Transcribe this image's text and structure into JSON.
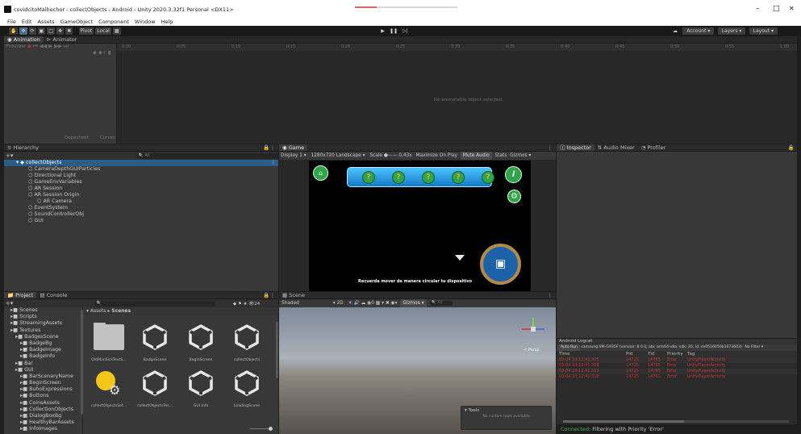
{
  "window": {
    "title": "covidcitoMalhechor - collectObjects - Android - Unity 2020.3.32f1 Personal <DX11>",
    "min": "–",
    "max": "□",
    "close": "✕"
  },
  "menu": [
    "File",
    "Edit",
    "Assets",
    "GameObject",
    "Component",
    "Window",
    "Help"
  ],
  "toolbar": {
    "pivot": "Pivot",
    "local": "Local",
    "account": "Account",
    "layers": "Layers",
    "layout": "Layout"
  },
  "animation": {
    "tabs": [
      "Animation",
      "Animator"
    ],
    "preview": "Preview",
    "ruler": [
      "0:00",
      "0:05",
      "0:10",
      "0:15",
      "0:20",
      "0:25",
      "0:30",
      "0:35",
      "0:40",
      "0:45",
      "0:50",
      "0:55",
      "1:00"
    ],
    "empty_message": "No animatable object selected.",
    "bottom_tabs": [
      "Dopesheet",
      "Curves"
    ]
  },
  "hierarchy": {
    "tab": "Hierarchy",
    "search_placeholder": "All",
    "scene": "collectObjects",
    "items": [
      {
        "label": "CameraDepthGUIParticles",
        "indent": 2
      },
      {
        "label": "Directional Light",
        "indent": 2
      },
      {
        "label": "GameEnvVariables",
        "indent": 2
      },
      {
        "label": "AR Session",
        "indent": 2
      },
      {
        "label": "AR Session Origin",
        "indent": 2
      },
      {
        "label": "AR Camera",
        "indent": 3
      },
      {
        "label": "EventSystem",
        "indent": 2
      },
      {
        "label": "SoundControllerObj",
        "indent": 2
      },
      {
        "label": "GUI",
        "indent": 2
      }
    ]
  },
  "game": {
    "tab": "Game",
    "display": "Display 1",
    "resolution": "1280x720 Landscape",
    "scale_label": "Scale",
    "scale_value": "0.43x",
    "toggles": [
      "Maximize On Play",
      "Mute Audio",
      "Stats",
      "Gizmos"
    ],
    "footer_text": "Recuerda mover de manera circular tu dispositivo",
    "tokens": [
      "?",
      "?",
      "?",
      "?",
      "?"
    ],
    "info_glyph": "i"
  },
  "inspector": {
    "tabs": [
      "Inspector",
      "Audio Mixer",
      "Profiler"
    ]
  },
  "project": {
    "tabs": [
      "Project",
      "Console"
    ],
    "count": "24",
    "breadcrumb": [
      "Assets",
      "Scenes"
    ],
    "tree": [
      {
        "label": "Scenes",
        "indent": 1
      },
      {
        "label": "Scripts",
        "indent": 1
      },
      {
        "label": "StreamingAssets",
        "indent": 1
      },
      {
        "label": "Textures",
        "indent": 1
      },
      {
        "label": "BadgesScene",
        "indent": 2
      },
      {
        "label": "BadgeBg",
        "indent": 3
      },
      {
        "label": "BadgeImage",
        "indent": 3
      },
      {
        "label": "BadgeInfo",
        "indent": 3
      },
      {
        "label": "Bar",
        "indent": 2
      },
      {
        "label": "GUI",
        "indent": 2
      },
      {
        "label": "BarScenaryName",
        "indent": 3
      },
      {
        "label": "BeginScreen",
        "indent": 3
      },
      {
        "label": "BuhoExpressions",
        "indent": 3
      },
      {
        "label": "Buttons",
        "indent": 3
      },
      {
        "label": "CoinsAssets",
        "indent": 3
      },
      {
        "label": "CollectionObjects",
        "indent": 3
      },
      {
        "label": "DialogBoxBg",
        "indent": 3
      },
      {
        "label": "HealthyBarAssets",
        "indent": 3
      },
      {
        "label": "InfoImages",
        "indent": 3
      }
    ],
    "assets": [
      {
        "label": "OldManSickTextS...",
        "kind": "folder"
      },
      {
        "label": "BadgeScene",
        "kind": "unity"
      },
      {
        "label": "BeginScreen",
        "kind": "unity"
      },
      {
        "label": "collectObjects",
        "kind": "unity"
      },
      {
        "label": "collectObjectsSet...",
        "kind": "lighting"
      },
      {
        "label": "collectObjectsTes...",
        "kind": "unity"
      },
      {
        "label": "GUI Info",
        "kind": "unity"
      },
      {
        "label": "LoadingScene",
        "kind": "unity"
      }
    ]
  },
  "scene": {
    "tab": "Scene",
    "shading": "Shaded",
    "mode_2d": "2D",
    "gizmos": "Gizmos",
    "search_placeholder": "All",
    "persp": "< Persp",
    "tools_title": "Tools",
    "tools_message": "No custom tools available"
  },
  "logcat": {
    "title": "Android Logcat",
    "auto_run": "Auto Run",
    "device": "samsung SM-G935F (version: 8.0.0, abi: arm64-v8a, sdk: 26, id: ce0516050b1073603)",
    "filter": "No Filter",
    "columns": [
      "Time",
      "Pid",
      "Tid",
      "Priority",
      "Tag"
    ],
    "rows": [
      [
        "03-04 10:12:41.305",
        "14725",
        "14765",
        "Error",
        "UnityPlayerActivity"
      ],
      [
        "03-04 10:12:41.308",
        "14725",
        "14765",
        "Error",
        "UnityPlayerActivity"
      ],
      [
        "03-04 10:12:41.311",
        "14725",
        "14765",
        "Error",
        "UnityPlayerActivity"
      ],
      [
        "03-04 10:12:41.318",
        "14725",
        "14765",
        "Error",
        "UnityPlayerActivity"
      ]
    ],
    "status_connected": "Connected",
    "status_text": ": Filtering with Priority 'Error'"
  },
  "colors": {
    "accent": "#2c5d87",
    "error": "#c93535",
    "connected": "#43b34a",
    "game_bar": "#1a8fd8",
    "coin": "#2fa44a"
  }
}
